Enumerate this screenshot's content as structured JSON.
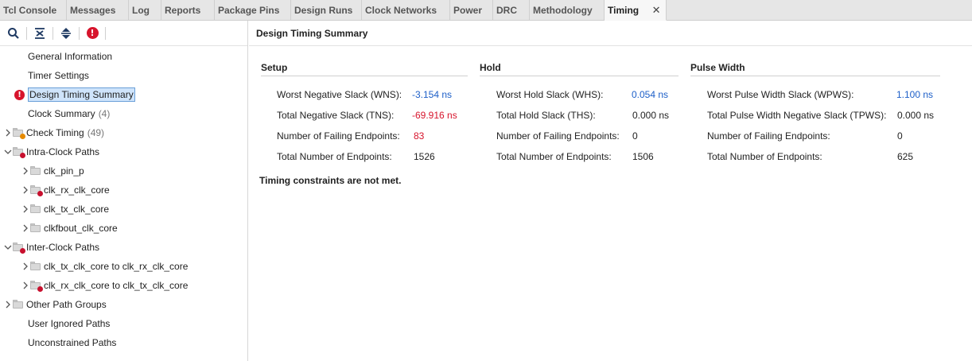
{
  "tabs": [
    {
      "label": "Tcl Console"
    },
    {
      "label": "Messages"
    },
    {
      "label": "Log"
    },
    {
      "label": "Reports"
    },
    {
      "label": "Package Pins"
    },
    {
      "label": "Design Runs"
    },
    {
      "label": "Clock Networks"
    },
    {
      "label": "Power"
    },
    {
      "label": "DRC"
    },
    {
      "label": "Methodology"
    },
    {
      "label": "Timing",
      "active": true
    }
  ],
  "toolbar": {
    "icons": [
      "search-icon",
      "collapse-all-icon",
      "expand-all-icon",
      "error-icon"
    ]
  },
  "tree": {
    "items": [
      {
        "label": "General Information"
      },
      {
        "label": "Timer Settings"
      },
      {
        "label": "Design Timing Summary"
      },
      {
        "label": "Clock Summary",
        "count": "(4)"
      },
      {
        "label": "Check Timing",
        "count": "(49)"
      },
      {
        "label": "Intra-Clock Paths"
      },
      {
        "label": "clk_pin_p"
      },
      {
        "label": "clk_rx_clk_core"
      },
      {
        "label": "clk_tx_clk_core"
      },
      {
        "label": "clkfbout_clk_core"
      },
      {
        "label": "Inter-Clock Paths"
      },
      {
        "label": "clk_tx_clk_core to clk_rx_clk_core"
      },
      {
        "label": "clk_rx_clk_core to clk_tx_clk_core"
      },
      {
        "label": "Other Path Groups"
      },
      {
        "label": "User Ignored Paths"
      },
      {
        "label": "Unconstrained Paths"
      }
    ]
  },
  "summary": {
    "title": "Design Timing Summary",
    "setup": {
      "title": "Setup",
      "rows": [
        {
          "label": "Worst Negative Slack (WNS):",
          "value": "-3.154 ns"
        },
        {
          "label": "Total Negative Slack (TNS):",
          "value": "-69.916 ns"
        },
        {
          "label": "Number of Failing Endpoints:",
          "value": "83"
        },
        {
          "label": "Total Number of Endpoints:",
          "value": "1526"
        }
      ]
    },
    "hold": {
      "title": "Hold",
      "rows": [
        {
          "label": "Worst Hold Slack (WHS):",
          "value": "0.054 ns"
        },
        {
          "label": "Total Hold Slack (THS):",
          "value": "0.000 ns"
        },
        {
          "label": "Number of Failing Endpoints:",
          "value": "0"
        },
        {
          "label": "Total Number of Endpoints:",
          "value": "1506"
        }
      ]
    },
    "pulse": {
      "title": "Pulse Width",
      "rows": [
        {
          "label": "Worst Pulse Width Slack (WPWS):",
          "value": "1.100 ns"
        },
        {
          "label": "Total Pulse Width Negative Slack (TPWS):",
          "value": "0.000 ns"
        },
        {
          "label": "Number of Failing Endpoints:",
          "value": "0"
        },
        {
          "label": "Total Number of Endpoints:",
          "value": "625"
        }
      ]
    },
    "note": "Timing constraints are not met.",
    "colors": {
      "link_blue": "#1d5fc8",
      "error_red": "#d7142c",
      "selection": "#cfe4fb"
    }
  }
}
